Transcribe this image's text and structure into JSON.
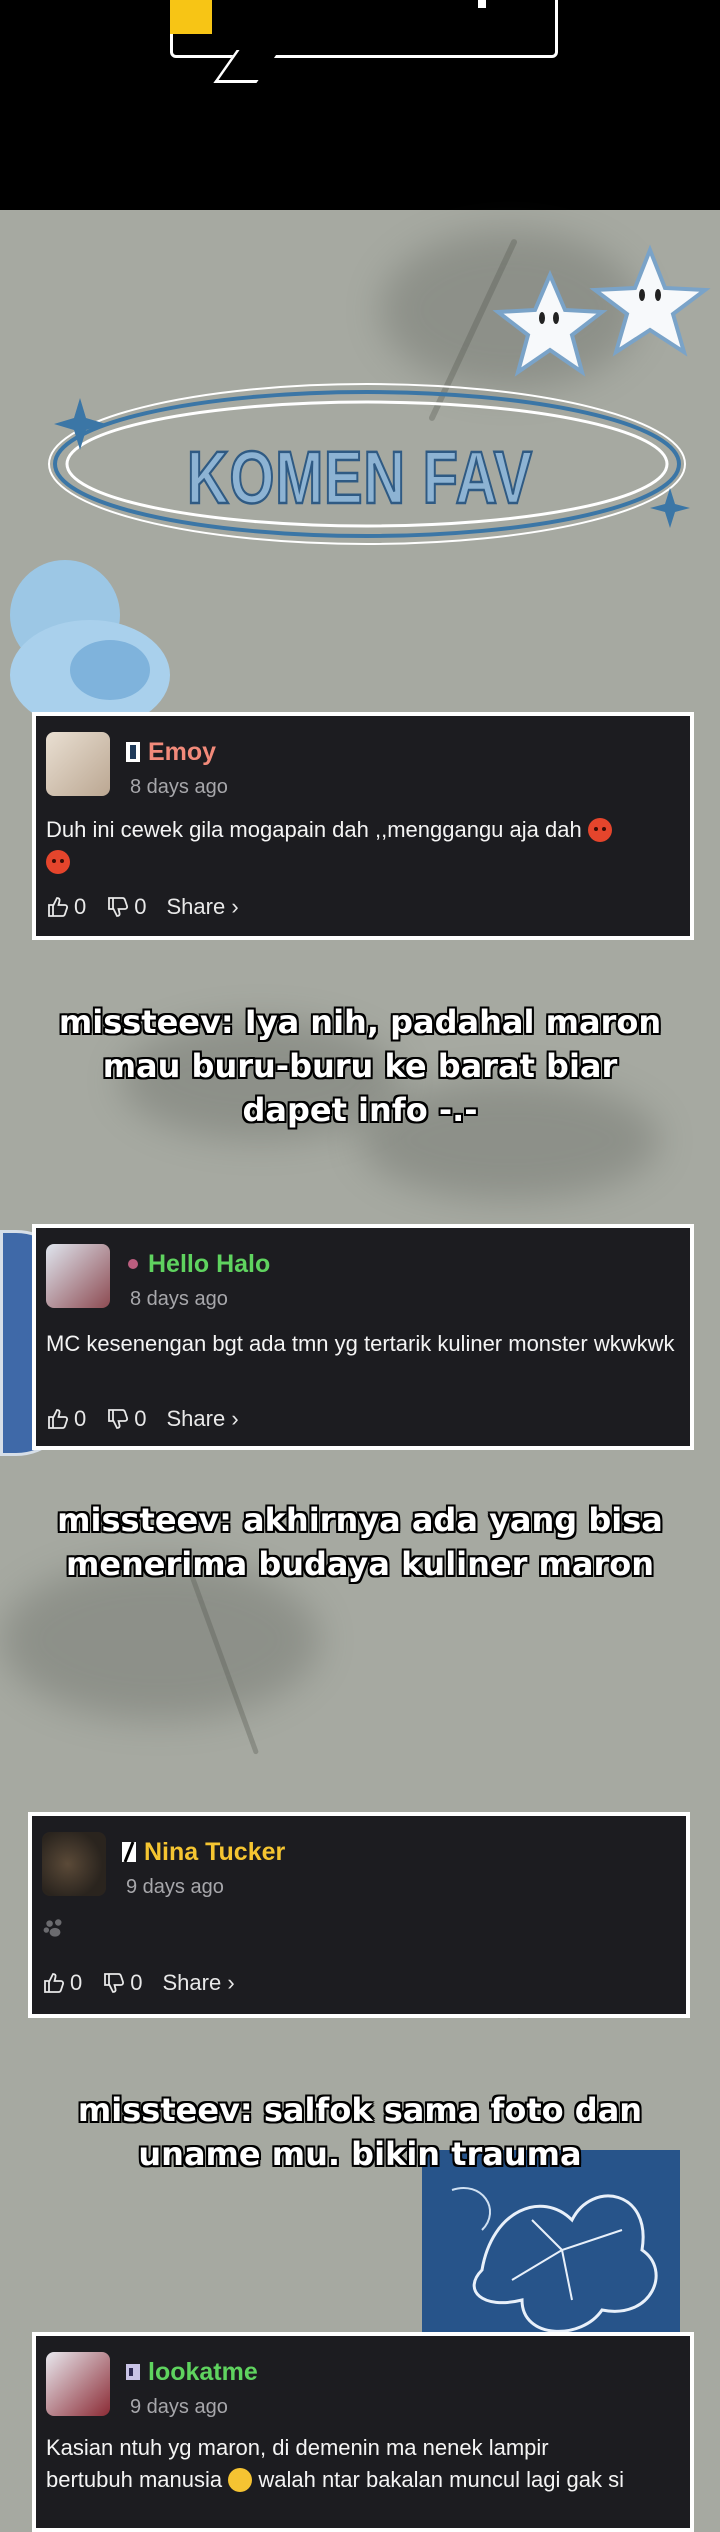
{
  "header": {
    "banner_text": ""
  },
  "title": {
    "text": "KOMEN FAV"
  },
  "comments": [
    {
      "username": "Emoy",
      "username_color": "#f28a7a",
      "time_ago": "8 days ago",
      "text": "Duh ini cewek gila mogapain dah ,,menggangu aja dah ",
      "likes": "0",
      "dislikes": "0",
      "share_label": "Share ›"
    },
    {
      "username": "Hello Halo",
      "username_color": "#5fd35f",
      "time_ago": "8 days ago",
      "text": "MC kesenengan bgt ada tmn yg tertarik kuliner monster wkwkwk",
      "likes": "0",
      "dislikes": "0",
      "share_label": "Share ›"
    },
    {
      "username": "Nina Tucker",
      "username_color": "#f5c531",
      "time_ago": "9 days ago",
      "text": "",
      "likes": "0",
      "dislikes": "0",
      "share_label": "Share ›"
    },
    {
      "username": "lookatme",
      "username_color": "#5fd35f",
      "time_ago": "9 days ago",
      "text_line1": "Kasian ntuh yg maron, di demenin ma nenek lampir",
      "text_line2a": "bertubuh manusia ",
      "text_line2b": " walah ntar bakalan muncul lagi gak si"
    }
  ],
  "captions": [
    {
      "line1": "missteev: Iya nih, padahal maron",
      "line2": "mau buru-buru ke barat biar",
      "line3": "dapet info -.-"
    },
    {
      "line1": "missteev: akhirnya ada yang bisa",
      "line2": "menerima budaya kuliner maron"
    },
    {
      "line1": "missteev: salfok sama foto dan",
      "line2": "uname mu. bikin trauma"
    }
  ],
  "icons": [
    "thumbs-up-icon",
    "thumbs-down-icon",
    "badge-icon",
    "angry-face-emoji",
    "grin-emoji",
    "paw-icon",
    "star-decoration",
    "sparkle-icon"
  ]
}
